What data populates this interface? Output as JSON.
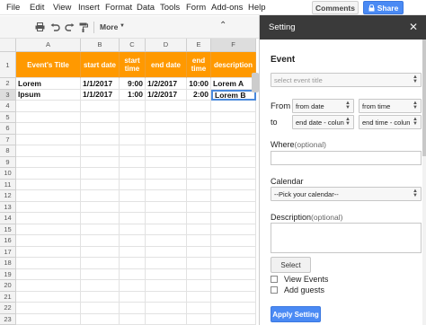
{
  "menu": {
    "items": [
      "File",
      "Edit",
      "View",
      "Insert",
      "Format",
      "Data",
      "Tools",
      "Form",
      "Add-ons",
      "Help"
    ],
    "comments_label": "Comments",
    "share_label": "Share"
  },
  "toolbar": {
    "icons": [
      "print-icon",
      "undo-icon",
      "redo-icon",
      "paint-format-icon"
    ],
    "more_label": "More",
    "collapse_icon": "chevron-up-double-icon"
  },
  "sheet": {
    "columns": [
      "A",
      "B",
      "C",
      "D",
      "E",
      "F"
    ],
    "selected_column": "F",
    "rows": [
      "1",
      "2",
      "3",
      "4",
      "5",
      "6",
      "7",
      "8",
      "9",
      "10",
      "11",
      "12",
      "13",
      "14",
      "15",
      "16",
      "17",
      "18",
      "19",
      "20",
      "21",
      "22",
      "23"
    ],
    "selected_row": "3",
    "header_cells": [
      "Event's Title",
      "start date",
      "start time",
      "end date",
      "end time",
      "description"
    ],
    "data_rows": [
      [
        "Lorem",
        "1/1/2017",
        "9:00",
        "1/2/2017",
        "10:00",
        "Lorem A"
      ],
      [
        "Ipsum",
        "1/1/2017",
        "1:00",
        "1/2/2017",
        "2:00",
        "Lorem B"
      ]
    ],
    "header_color": "#ff9900"
  },
  "sidebar": {
    "title": "Setting",
    "close": "✕",
    "event_label": "Event",
    "event_select": "select event title",
    "from_label": "From",
    "to_label": "to",
    "from_date": "from date",
    "from_time": "from time",
    "end_date": "end date - colun",
    "end_time": "end time - colun",
    "where_label": "Where",
    "where_optional": "(optional)",
    "calendar_label": "Calendar",
    "calendar_select": "--Pick your calendar--",
    "description_label": "Description",
    "description_optional": "(optional)",
    "select_button": "Select",
    "view_events_label": "View Events",
    "add_guests_label": "Add guests",
    "apply_button": "Apply Setting",
    "accent": "#4a8af4"
  }
}
